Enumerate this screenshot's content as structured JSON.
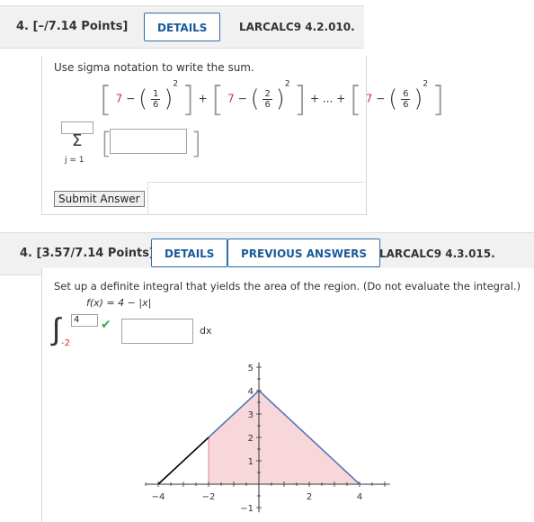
{
  "q1": {
    "number": "4. [–/7.14 Points]",
    "details_label": "DETAILS",
    "code": "LARCALC9 4.2.010.",
    "prompt": "Use sigma notation to write the sum.",
    "term7": "7",
    "minus": "−",
    "plus": "+",
    "ellipsis": "+ ... +",
    "frac1": {
      "n": "1",
      "d": "6"
    },
    "frac2": {
      "n": "2",
      "d": "6"
    },
    "frac3": {
      "n": "6",
      "d": "6"
    },
    "exp": "2",
    "sigma": "Σ",
    "lower_index": "j = 1",
    "submit_label": "Submit Answer"
  },
  "q2": {
    "number": "4. [3.57/7.14 Points]",
    "details_label": "DETAILS",
    "previous_label": "PREVIOUS ANSWERS",
    "code": "LARCALC9 4.3.015.",
    "prompt": "Set up a definite integral that yields the area of the region. (Do not evaluate the integral.)",
    "function": "f(x) = 4 − |x|",
    "upper_limit": "4",
    "lower_limit": "-2",
    "dx": "dx",
    "check": "✔"
  },
  "chart_data": {
    "type": "area",
    "function": "4 - |x|",
    "x_ticks": [
      "-4",
      "-2",
      "2",
      "4"
    ],
    "y_ticks": [
      "-1",
      "1",
      "2",
      "3",
      "4",
      "5"
    ],
    "xlim": [
      -4.5,
      5.2
    ],
    "ylim": [
      -1.2,
      5.2
    ],
    "line_points": [
      [
        -4,
        0
      ],
      [
        0,
        4
      ],
      [
        4,
        0
      ]
    ],
    "shaded_region": {
      "x_from": -2,
      "x_to": 4
    },
    "colors": {
      "line_left": "#000000",
      "line_right": "#5a76b6",
      "fill": "#f8d7db",
      "fill_stroke": "#e08a95"
    }
  }
}
